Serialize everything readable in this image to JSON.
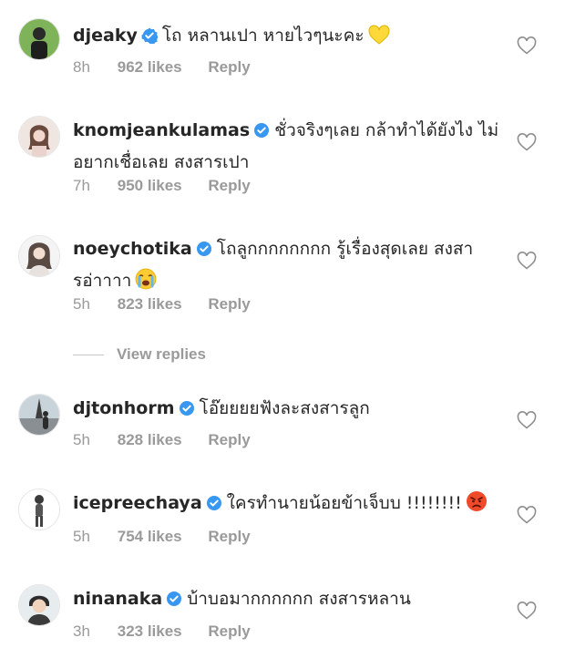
{
  "comments": [
    {
      "username": "djeaky",
      "text": "โถ หลานเปา หายไวๆนะคะ",
      "time": "8h",
      "likes": "962 likes",
      "reply": "Reply",
      "emoji": "yellow-heart"
    },
    {
      "username": "knomjeankulamas",
      "text": "ชั่วจริงๆเลย กล้าทำได้ยังไง ไม่อยากเชื่อเลย สงสารเปา",
      "time": "7h",
      "likes": "950 likes",
      "reply": "Reply"
    },
    {
      "username": "noeychotika",
      "text": "โถลูกกกกกกกก รู้เรื่องสุดเลย สงสารอ่าาาา",
      "time": "5h",
      "likes": "823 likes",
      "reply": "Reply",
      "emoji": "loudly-crying-face"
    },
    {
      "username": "djtonhorm",
      "text": "โอ๊ยยยยฟังละสงสารลูก",
      "time": "5h",
      "likes": "828 likes",
      "reply": "Reply"
    },
    {
      "username": "icepreechaya",
      "text": "ใครทำนายน้อยข้าเจ็บบ !!!!!!!!",
      "time": "5h",
      "likes": "754 likes",
      "reply": "Reply",
      "emoji": "angry-face"
    },
    {
      "username": "ninanaka",
      "text": "บ้าบอมากกกกกก สงสารหลาน",
      "time": "3h",
      "likes": "323 likes",
      "reply": "Reply"
    }
  ],
  "view_replies": "View replies",
  "colors": {
    "verified": "#3897f0",
    "meta": "#9a9a9a",
    "text": "#262626",
    "heart_outline": "#8e8e8e"
  }
}
